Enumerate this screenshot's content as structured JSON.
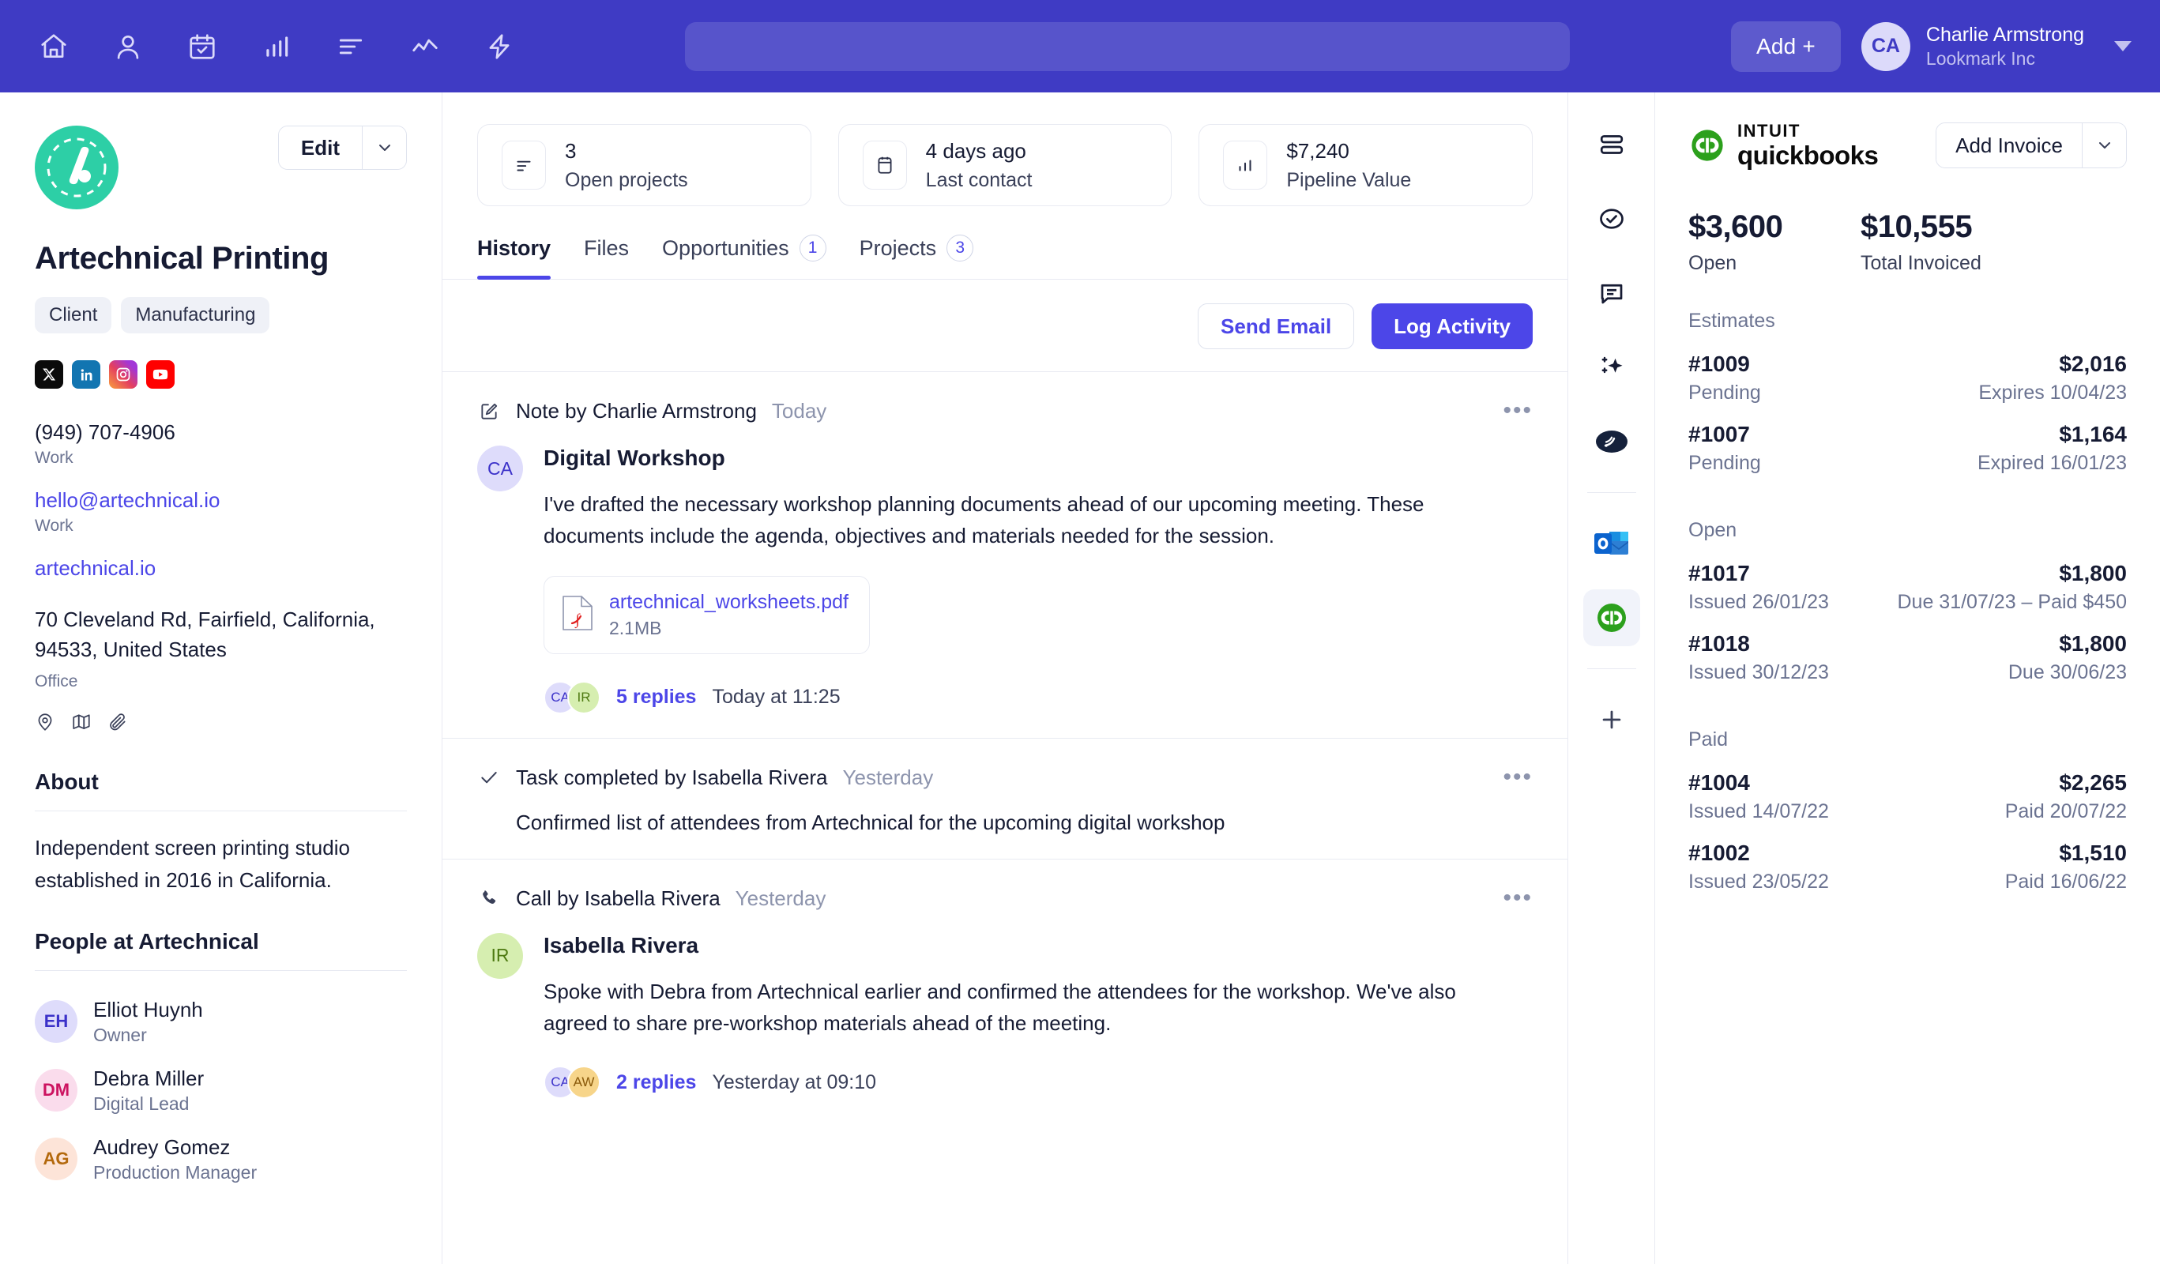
{
  "topbar": {
    "nav_icons": [
      "home-icon",
      "person-icon",
      "calendar-check-icon",
      "bar-chart-icon",
      "list-icon",
      "trend-line-icon",
      "lightning-icon"
    ],
    "search_placeholder": "",
    "search_value": "",
    "add_label": "Add +",
    "user": {
      "initials": "CA",
      "name": "Charlie Armstrong",
      "org": "Lookmark Inc"
    }
  },
  "left": {
    "edit_label": "Edit",
    "company_name": "Artechnical Printing",
    "tags": [
      "Client",
      "Manufacturing"
    ],
    "socials": [
      "x-icon",
      "linkedin-icon",
      "instagram-icon",
      "youtube-icon"
    ],
    "contacts": [
      {
        "value": "(949) 707-4906",
        "label": "Work",
        "link": false
      },
      {
        "value": "hello@artechnical.io",
        "label": "Work",
        "link": true
      },
      {
        "value": "artechnical.io",
        "label": "",
        "link": true
      }
    ],
    "address": "70 Cleveland Rd, Fairfield, California, 94533, United States",
    "address_label": "Office",
    "mini_icons": [
      "location-pin-icon",
      "map-icon",
      "paperclip-icon"
    ],
    "about_title": "About",
    "about_text": "Independent screen printing studio established in 2016 in California.",
    "people_title": "People at Artechnical",
    "people": [
      {
        "initials": "EH",
        "name": "Elliot Huynh",
        "role": "Owner",
        "bg": "#dedcfb",
        "fg": "#3b31c9"
      },
      {
        "initials": "DM",
        "name": "Debra Miller",
        "role": "Digital Lead",
        "bg": "#fadcec",
        "fg": "#cc1360"
      },
      {
        "initials": "AG",
        "name": "Audrey Gomez",
        "role": "Production Manager",
        "bg": "#fde4d8",
        "fg": "#b3690d"
      }
    ]
  },
  "center": {
    "stats": [
      {
        "icon": "list-icon",
        "value": "3",
        "label": "Open projects"
      },
      {
        "icon": "calendar-icon",
        "value": "4 days ago",
        "label": "Last contact"
      },
      {
        "icon": "bar-chart-icon",
        "value": "$7,240",
        "label": "Pipeline Value"
      }
    ],
    "tabs": [
      {
        "label": "History",
        "badge": "",
        "active": true
      },
      {
        "label": "Files",
        "badge": "",
        "active": false
      },
      {
        "label": "Opportunities",
        "badge": "1",
        "active": false
      },
      {
        "label": "Projects",
        "badge": "3",
        "active": false
      }
    ],
    "send_email_label": "Send Email",
    "log_activity_label": "Log Activity",
    "entries": [
      {
        "icon": "note-edit-icon",
        "title": "Note by Charlie Armstrong",
        "time": "Today",
        "avatar": {
          "initials": "CA",
          "bg": "#dedcfb",
          "fg": "#3b31c9"
        },
        "subject": "Digital Workshop",
        "text": "I've drafted the necessary workshop planning documents ahead of our upcoming meeting. These documents include the agenda, objectives and materials needed for the session.",
        "attachment": {
          "name": "artechnical_worksheets.pdf",
          "size": "2.1MB",
          "type": "pdf-icon"
        },
        "replies": {
          "avatars": [
            {
              "initials": "CA",
              "bg": "#dedcfb",
              "fg": "#3b31c9"
            },
            {
              "initials": "IR",
              "bg": "#d6eeb0",
              "fg": "#4e7a12"
            }
          ],
          "link": "5 replies",
          "time": "Today at 11:25"
        }
      },
      {
        "icon": "check-icon",
        "title": "Task completed by Isabella Rivera",
        "time": "Yesterday",
        "plain_text": "Confirmed list of attendees from Artechnical for the upcoming digital workshop"
      },
      {
        "icon": "phone-icon",
        "title": "Call by Isabella Rivera",
        "time": "Yesterday",
        "avatar": {
          "initials": "IR",
          "bg": "#d6eeb0",
          "fg": "#4e7a12"
        },
        "subject": "Isabella Rivera",
        "text": "Spoke with Debra from Artechnical earlier and confirmed the attendees for the workshop. We've also agreed to share pre-workshop materials ahead of the meeting.",
        "replies": {
          "avatars": [
            {
              "initials": "CA",
              "bg": "#dedcfb",
              "fg": "#3b31c9"
            },
            {
              "initials": "AW",
              "bg": "#f7d58a",
              "fg": "#8a5a0b"
            }
          ],
          "link": "2 replies",
          "time": "Yesterday at 09:10"
        }
      }
    ]
  },
  "rail": {
    "items": [
      "layout-icon",
      "check-circle-icon",
      "comment-icon",
      "sparkle-icon",
      "signal-badge-icon",
      "outlook-icon",
      "quickbooks-icon",
      "plus-icon"
    ]
  },
  "right": {
    "brand_intuit": "INTUIT",
    "brand_name": "quickbooks",
    "add_invoice_label": "Add Invoice",
    "totals": [
      {
        "value": "$3,600",
        "label": "Open"
      },
      {
        "value": "$10,555",
        "label": "Total Invoiced"
      }
    ],
    "sections": [
      {
        "title": "Estimates",
        "rows": [
          {
            "id": "#1009",
            "amount": "$2,016",
            "status": "Pending",
            "meta": "Expires 10/04/23"
          },
          {
            "id": "#1007",
            "amount": "$1,164",
            "status": "Pending",
            "meta": "Expired 16/01/23"
          }
        ]
      },
      {
        "title": "Open",
        "rows": [
          {
            "id": "#1017",
            "amount": "$1,800",
            "status": "Issued 26/01/23",
            "meta": "Due 31/07/23 – Paid $450"
          },
          {
            "id": "#1018",
            "amount": "$1,800",
            "status": "Issued 30/12/23",
            "meta": "Due 30/06/23"
          }
        ]
      },
      {
        "title": "Paid",
        "rows": [
          {
            "id": "#1004",
            "amount": "$2,265",
            "status": "Issued 14/07/22",
            "meta": "Paid 20/07/22"
          },
          {
            "id": "#1002",
            "amount": "$1,510",
            "status": "Issued 23/05/22",
            "meta": "Paid 16/06/22"
          }
        ]
      }
    ]
  },
  "colors": {
    "brand": "#3f3bc4",
    "accent": "#4c46e8",
    "logo_green": "#2dcfa6",
    "qb_green": "#2ca01c"
  }
}
